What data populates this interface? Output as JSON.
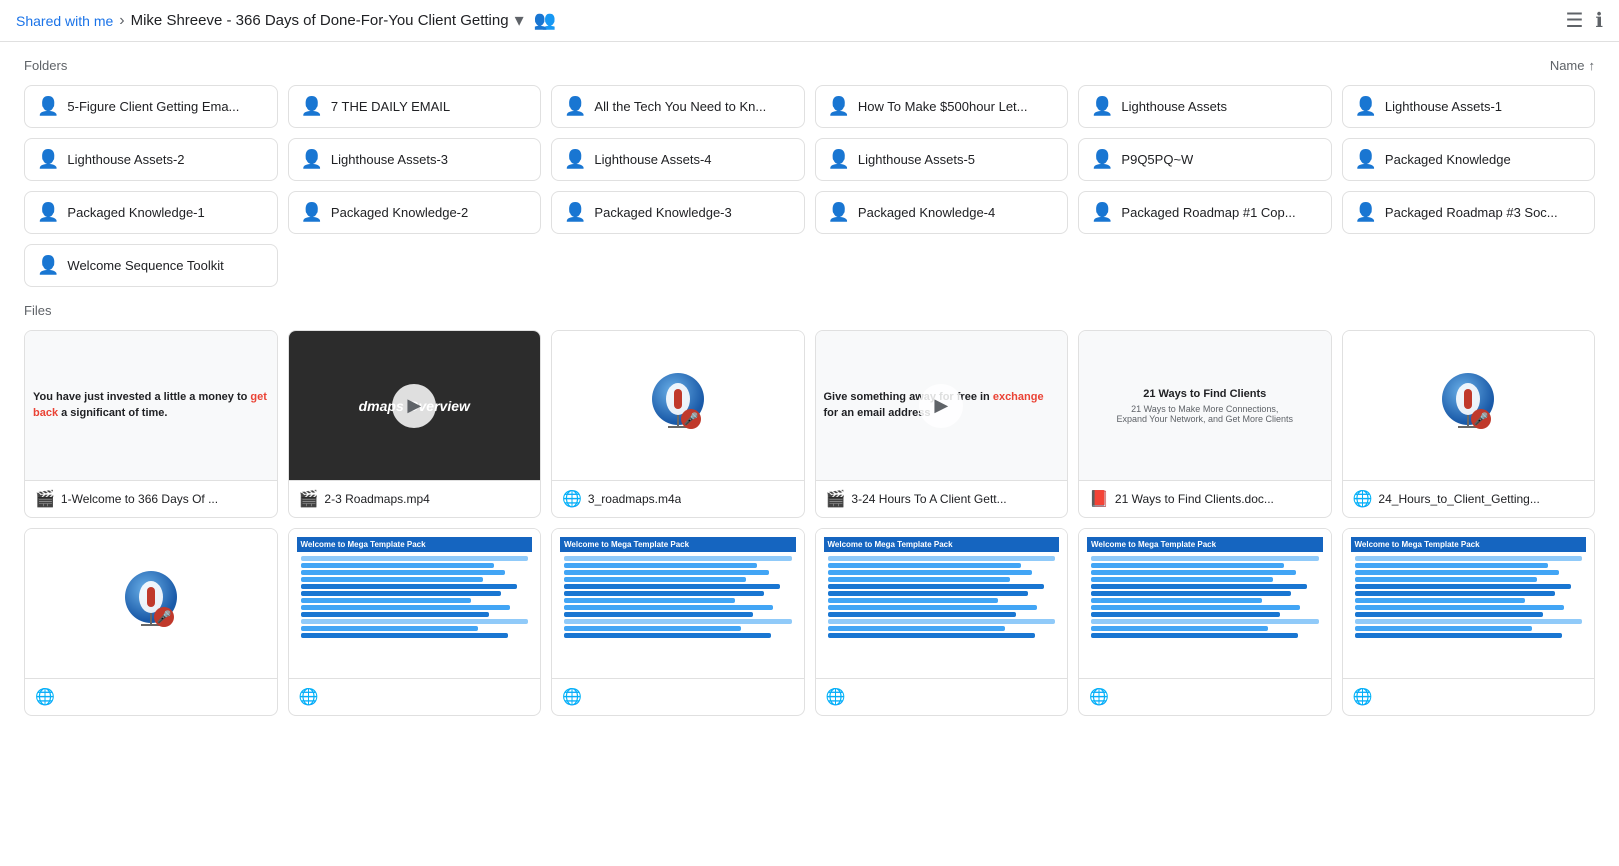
{
  "header": {
    "breadcrumb_shared": "Shared with me",
    "breadcrumb_current": "Mike Shreeve - 366 Days of Done-For-You Client Getting",
    "sort_label": "Name",
    "sort_arrow": "↑"
  },
  "folders_label": "Folders",
  "files_label": "Files",
  "folders": [
    {
      "id": 1,
      "name": "5-Figure Client Getting Ema..."
    },
    {
      "id": 2,
      "name": "7 THE DAILY EMAIL"
    },
    {
      "id": 3,
      "name": "All the Tech You Need to Kn..."
    },
    {
      "id": 4,
      "name": "How To Make $500hour Let..."
    },
    {
      "id": 5,
      "name": "Lighthouse Assets"
    },
    {
      "id": 6,
      "name": "Lighthouse Assets-1"
    },
    {
      "id": 7,
      "name": "Lighthouse Assets-2"
    },
    {
      "id": 8,
      "name": "Lighthouse Assets-3"
    },
    {
      "id": 9,
      "name": "Lighthouse Assets-4"
    },
    {
      "id": 10,
      "name": "Lighthouse Assets-5"
    },
    {
      "id": 11,
      "name": "P9Q5PQ~W"
    },
    {
      "id": 12,
      "name": "Packaged Knowledge"
    },
    {
      "id": 13,
      "name": "Packaged Knowledge-1"
    },
    {
      "id": 14,
      "name": "Packaged Knowledge-2"
    },
    {
      "id": 15,
      "name": "Packaged Knowledge-3"
    },
    {
      "id": 16,
      "name": "Packaged Knowledge-4"
    },
    {
      "id": 17,
      "name": "Packaged Roadmap #1 Cop..."
    },
    {
      "id": 18,
      "name": "Packaged Roadmap #3 Soc..."
    },
    {
      "id": 19,
      "name": "Welcome Sequence Toolkit"
    }
  ],
  "files": [
    {
      "id": 1,
      "name": "1-Welcome to 366 Days Of ...",
      "type": "video",
      "thumbnail_type": "text_bold",
      "thumbnail_text": "You have just invested a little a money to get back a significant of time.",
      "has_play": false
    },
    {
      "id": 2,
      "name": "2-3 Roadmaps.mp4",
      "type": "video",
      "thumbnail_type": "roadmaps",
      "has_play": true
    },
    {
      "id": 3,
      "name": "3_roadmaps.m4a",
      "type": "audio",
      "thumbnail_type": "mic",
      "has_play": false
    },
    {
      "id": 4,
      "name": "3-24 Hours To A Client Gett...",
      "type": "video",
      "thumbnail_type": "text_exchange",
      "has_play": true
    },
    {
      "id": 5,
      "name": "21 Ways to Find Clients.doc...",
      "type": "doc",
      "thumbnail_type": "ways",
      "has_play": false
    },
    {
      "id": 6,
      "name": "24_Hours_to_Client_Getting...",
      "type": "audio",
      "thumbnail_type": "mic",
      "has_play": false
    },
    {
      "id": 7,
      "name": "",
      "type": "audio",
      "thumbnail_type": "mic",
      "has_play": false
    },
    {
      "id": 8,
      "name": "",
      "type": "doc",
      "thumbnail_type": "mega_template",
      "has_play": false
    },
    {
      "id": 9,
      "name": "",
      "type": "doc",
      "thumbnail_type": "mega_template",
      "has_play": false
    },
    {
      "id": 10,
      "name": "",
      "type": "doc",
      "thumbnail_type": "mega_template",
      "has_play": false
    },
    {
      "id": 11,
      "name": "",
      "type": "doc",
      "thumbnail_type": "mega_template",
      "has_play": false
    },
    {
      "id": 12,
      "name": "",
      "type": "doc",
      "thumbnail_type": "mega_template",
      "has_play": false
    }
  ],
  "icons": {
    "folder": "👤",
    "video": "🎬",
    "audio": "🌐",
    "doc": "📄",
    "pdf": "📕",
    "list_view": "☰",
    "info": "ℹ",
    "chevron_right": "›",
    "chevron_down": "▾",
    "people": "👥",
    "play": "▶"
  }
}
